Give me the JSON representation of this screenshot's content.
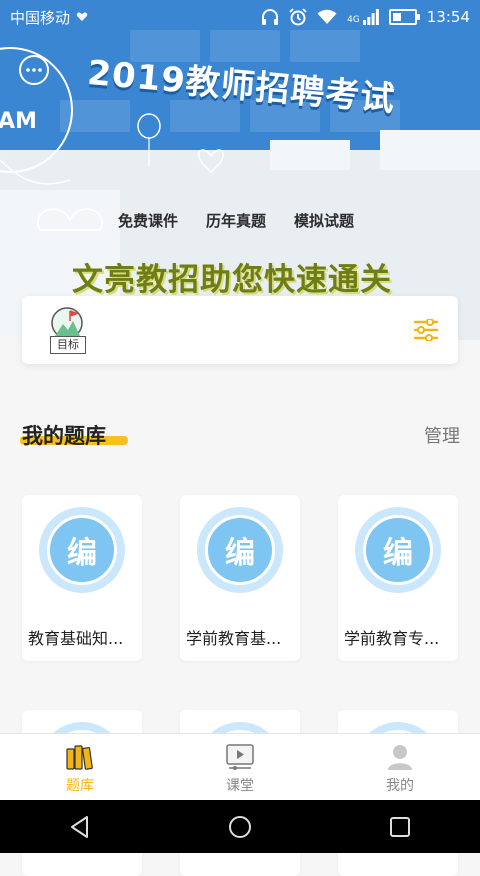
{
  "status_bar": {
    "carrier": "中国移动",
    "time": "13:54",
    "network": "4G",
    "battery_level": 0.4
  },
  "banner": {
    "title": "2019教师招聘考试",
    "links": [
      "免费课件",
      "历年真题",
      "模拟试题"
    ],
    "slogan": "文亮教招助您快速通关",
    "doodle_text": "AM",
    "colors": {
      "wall": "#3b86d3",
      "slogan": "#6f7d16"
    }
  },
  "goal": {
    "label": "目标",
    "icon": "target-flag-icon",
    "filter_icon": "filter-sliders-icon"
  },
  "section": {
    "title": "我的题库",
    "manage_label": "管理"
  },
  "question_banks": [
    {
      "icon_char": "编",
      "name": "教育基础知..."
    },
    {
      "icon_char": "编",
      "name": "学前教育基..."
    },
    {
      "icon_char": "编",
      "name": "学前教育专..."
    },
    {
      "icon_char": "",
      "name": ""
    },
    {
      "icon_char": "",
      "name": ""
    },
    {
      "icon_char": "",
      "name": ""
    }
  ],
  "tabs": [
    {
      "label": "题库",
      "icon": "books-icon",
      "active": true
    },
    {
      "label": "课堂",
      "icon": "video-play-icon",
      "active": false
    },
    {
      "label": "我的",
      "icon": "person-icon",
      "active": false
    }
  ],
  "accent_color": "#f3b415"
}
